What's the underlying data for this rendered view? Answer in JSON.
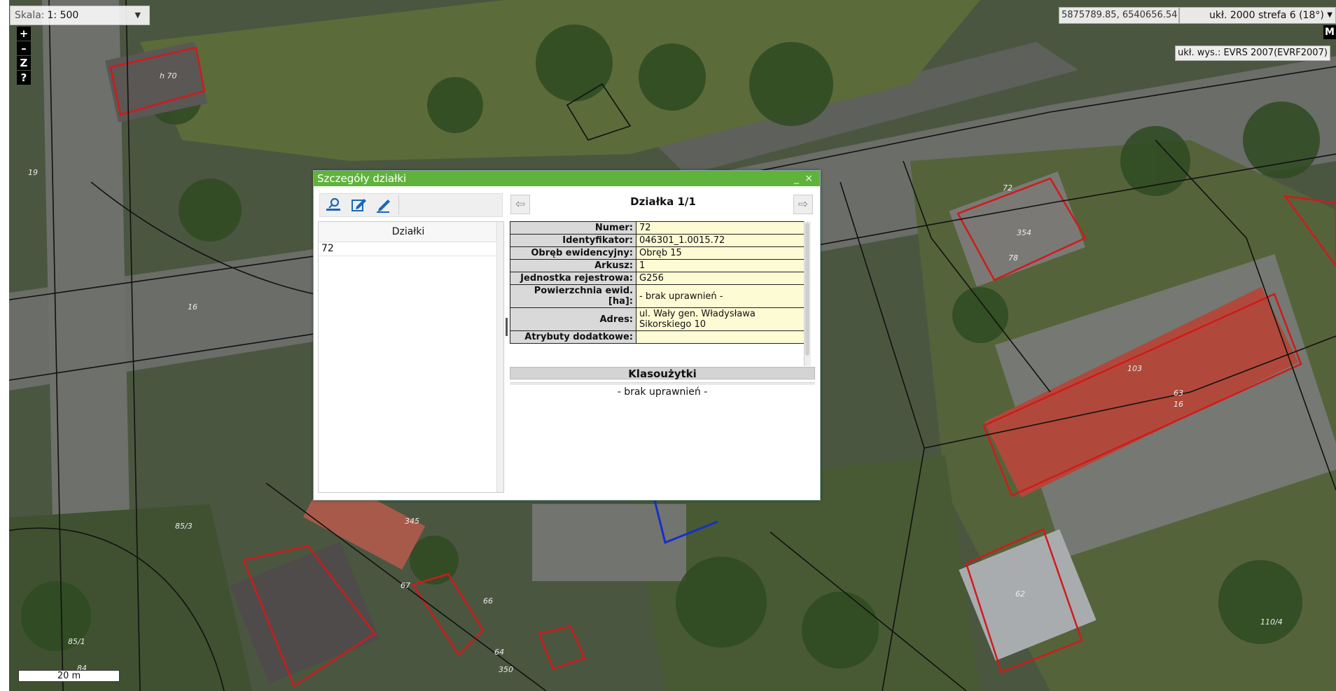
{
  "map": {
    "scale_label": "Skala:",
    "scale_value": "1: 500",
    "coordinates": "5875789.85, 6540656.54",
    "crs": "ukł. 2000 strefa 6 (18°)",
    "height_system": "ukł. wys.: EVRS 2007(EVRF2007)",
    "m_button": "M",
    "scalebar": "20 m",
    "zoom_in": "+",
    "zoom_out": "–",
    "zoom_z": "Z",
    "help": "?",
    "parcel_labels": [
      "h 70",
      "19",
      "16",
      "72",
      "354",
      "78",
      "103",
      "63",
      "16",
      "62",
      "110/4",
      "85/3",
      "85/1",
      "84",
      "67",
      "66",
      "64",
      "345",
      "350"
    ],
    "colors": {
      "parcel_outline": "#d11a1a",
      "border": "#111111"
    }
  },
  "dialog": {
    "title": "Szczegóły działki",
    "minimize": "_",
    "close": "×",
    "toolbar": [
      "locate-parcel-icon",
      "edit-icon",
      "pencil-icon"
    ],
    "list": {
      "header": "Działki",
      "items": [
        "72"
      ]
    },
    "nav": {
      "title": "Działka 1/1",
      "prev": "⇦",
      "next": "⇨"
    },
    "attributes": [
      {
        "label": "Numer:",
        "value": "72"
      },
      {
        "label": "Identyfikator:",
        "value": "046301_1.0015.72"
      },
      {
        "label": "Obręb ewidencyjny:",
        "value": "Obręb 15"
      },
      {
        "label": "Arkusz:",
        "value": "1"
      },
      {
        "label": "Jednostka rejestrowa:",
        "value": "G256"
      },
      {
        "label": "Powierzchnia ewid. [ha]:",
        "value": "- brak uprawnień -"
      },
      {
        "label": "Adres:",
        "value": "ul. Wały gen. Władysława Sikorskiego 10"
      },
      {
        "label": "Atrybuty dodatkowe:",
        "value": ""
      }
    ],
    "klasouzytki": {
      "header": "Klasoużytki",
      "message": "- brak uprawnień -"
    },
    "colors": {
      "titlebar": "#5fb33a",
      "key_bg": "#d9d9d9",
      "value_bg": "#fdfbd4"
    }
  }
}
